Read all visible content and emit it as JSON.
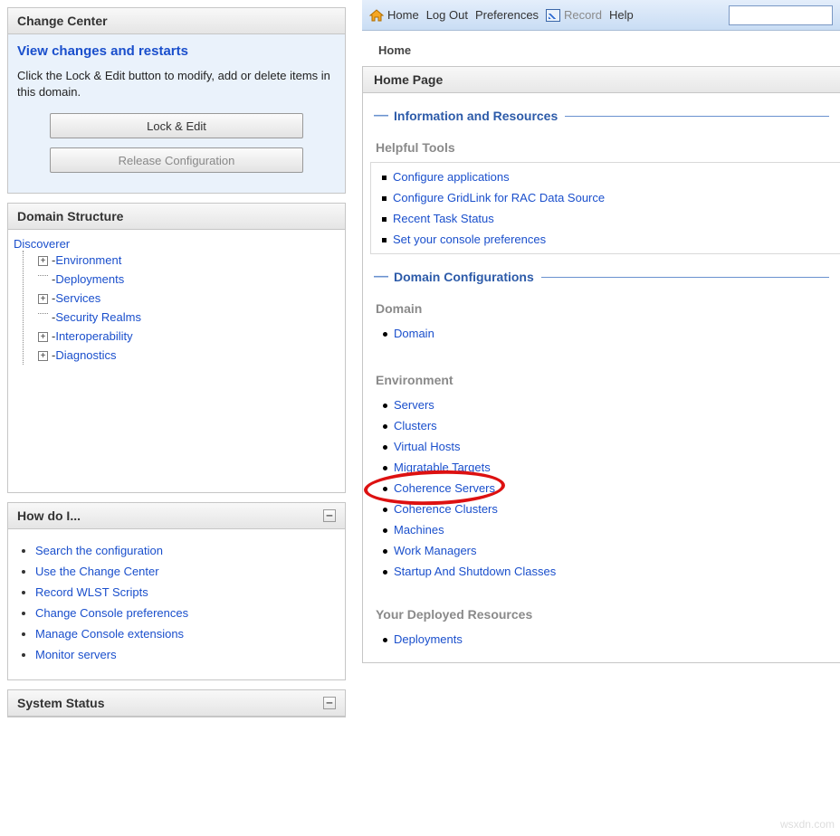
{
  "change_center": {
    "title": "Change Center",
    "view_link": "View changes and restarts",
    "hint": "Click the Lock & Edit button to modify, add or delete items in this domain.",
    "lock_btn": "Lock & Edit",
    "release_btn": "Release Configuration"
  },
  "domain_structure": {
    "title": "Domain Structure",
    "root": "Discoverer",
    "nodes": [
      {
        "label": "Environment",
        "expandable": true
      },
      {
        "label": "Deployments",
        "expandable": false
      },
      {
        "label": "Services",
        "expandable": true
      },
      {
        "label": "Security Realms",
        "expandable": false
      },
      {
        "label": "Interoperability",
        "expandable": true
      },
      {
        "label": "Diagnostics",
        "expandable": true
      }
    ]
  },
  "how_do_i": {
    "title": "How do I...",
    "items": [
      "Search the configuration",
      "Use the Change Center",
      "Record WLST Scripts",
      "Change Console preferences",
      "Manage Console extensions",
      "Monitor servers"
    ]
  },
  "system_status": {
    "title": "System Status"
  },
  "topbar": {
    "home": "Home",
    "logout": "Log Out",
    "prefs": "Preferences",
    "record": "Record",
    "help": "Help"
  },
  "breadcrumb": "Home",
  "page_title": "Home Page",
  "sections": {
    "info": {
      "title": "Information and Resources",
      "helpful_title": "Helpful Tools",
      "helpful_items": [
        "Configure applications",
        "Configure GridLink for RAC Data Source",
        "Recent Task Status",
        "Set your console preferences"
      ]
    },
    "domain_cfg": {
      "title": "Domain Configurations",
      "domain_title": "Domain",
      "domain_items": [
        "Domain"
      ],
      "env_title": "Environment",
      "env_items": [
        "Servers",
        "Clusters",
        "Virtual Hosts",
        "Migratable Targets",
        "Coherence Servers",
        "Coherence Clusters",
        "Machines",
        "Work Managers",
        "Startup And Shutdown Classes"
      ],
      "deployed_title": "Your Deployed Resources",
      "deployed_items": [
        "Deployments"
      ]
    }
  },
  "watermark": "wsxdn.com"
}
